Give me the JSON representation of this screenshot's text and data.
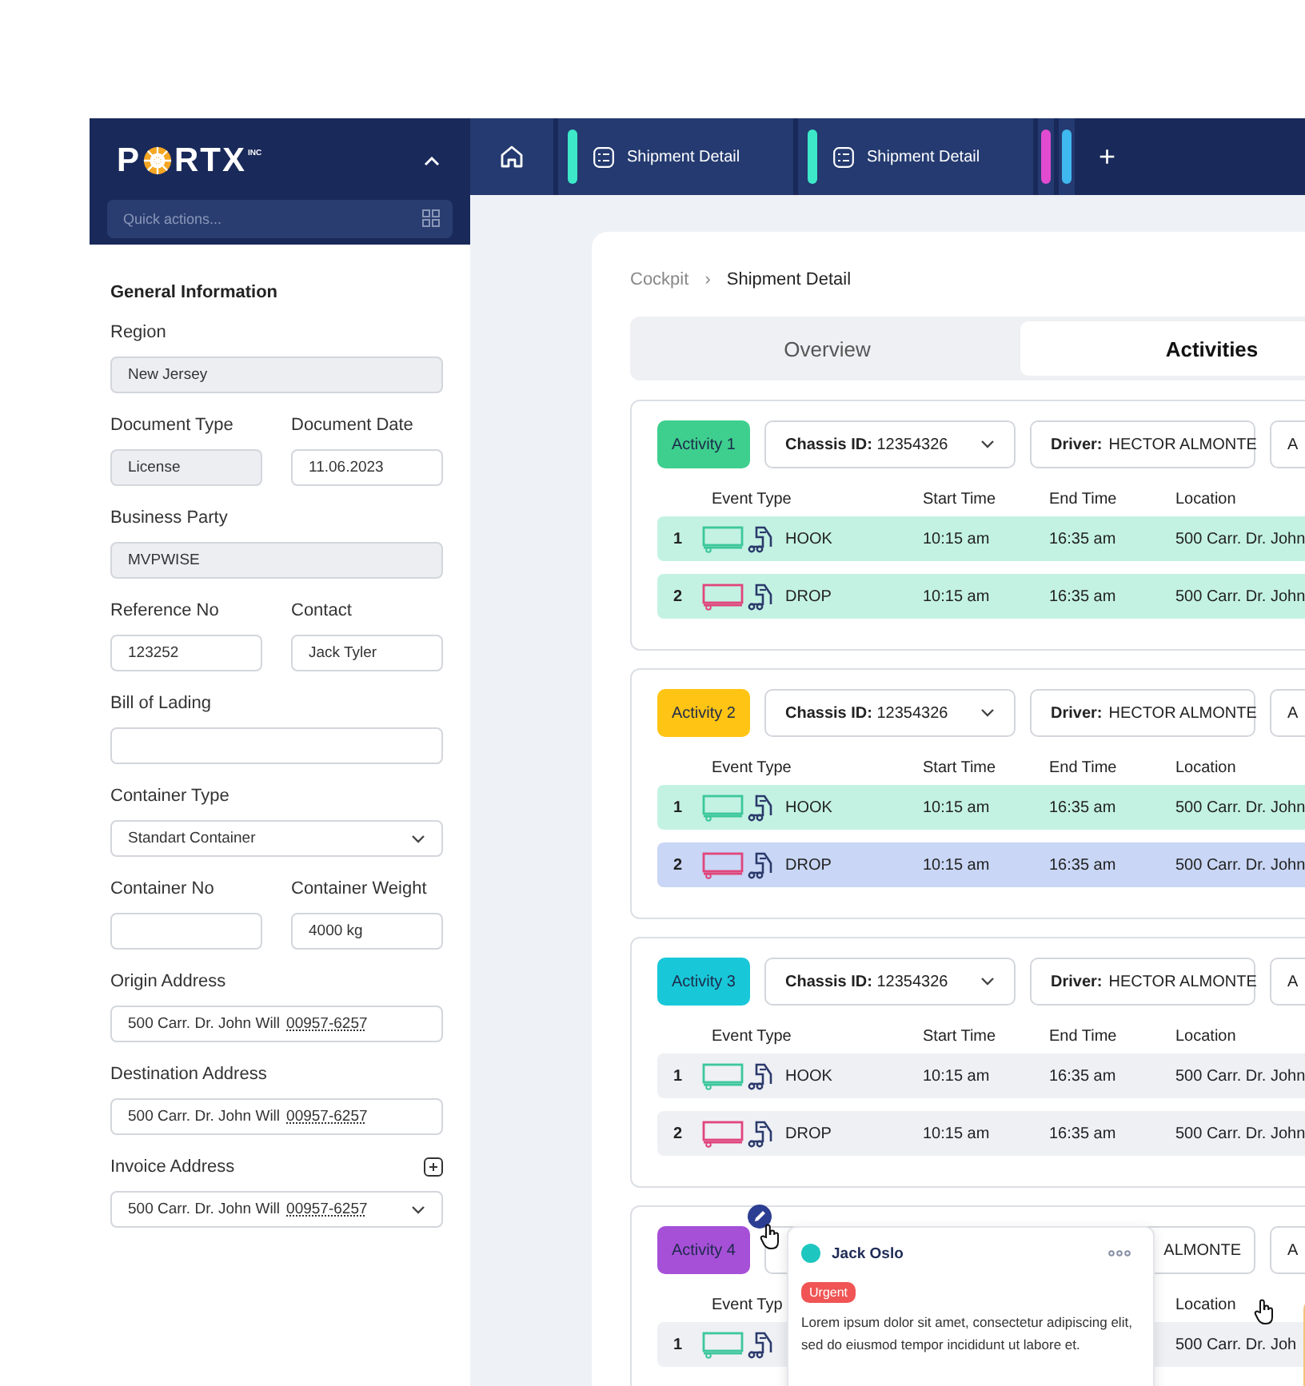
{
  "sidebar": {
    "logo": {
      "before": "P",
      "after": "RTX",
      "suffix": "INC"
    },
    "quick_actions": {
      "placeholder": "Quick actions..."
    },
    "section_title": "General Information",
    "rows": [
      [
        {
          "label": "Region",
          "value": "New Jersey",
          "kind": "readonly"
        }
      ],
      [
        {
          "label": "Document Type",
          "value": "License",
          "kind": "readonly"
        },
        {
          "label": "Document Date",
          "value": "11.06.2023",
          "kind": "input"
        }
      ],
      [
        {
          "label": "Business Party",
          "value": "MVPWISE",
          "kind": "readonly"
        }
      ],
      [
        {
          "label": "Reference No",
          "value": "123252",
          "kind": "input"
        },
        {
          "label": "Contact",
          "value": "Jack Tyler",
          "kind": "input"
        }
      ],
      [
        {
          "label": "Bill of Lading",
          "kind": "input"
        }
      ],
      [
        {
          "label": "Container Type",
          "value": "Standart Container",
          "kind": "select"
        }
      ],
      [
        {
          "label": "Container No",
          "kind": "input"
        },
        {
          "label": "Container Weight",
          "value": "4000 kg",
          "kind": "input"
        }
      ],
      [
        {
          "label": "Origin Address",
          "value": "500 Carr. Dr. John Will",
          "code": "00957-6257",
          "kind": "input"
        }
      ],
      [
        {
          "label": "Destination Address",
          "value": "500 Carr. Dr. John Will",
          "code": "00957-6257",
          "kind": "input"
        }
      ],
      [
        {
          "label": "Invoice Address",
          "value": "500 Carr. Dr. John Will",
          "code": "00957-6257",
          "kind": "select",
          "add_button": true
        }
      ]
    ]
  },
  "top_tabs": [
    {
      "kind": "home"
    },
    {
      "kind": "page",
      "label": "Shipment Detail",
      "color": "#3de8c8"
    },
    {
      "kind": "page",
      "label": "Shipment Detail",
      "color": "#3de8c8"
    },
    {
      "kind": "stub",
      "color": "#e04bd0"
    },
    {
      "kind": "stub",
      "color": "#3fb8ef"
    },
    {
      "kind": "add",
      "label": "+"
    }
  ],
  "breadcrumb": {
    "items": [
      "Cockpit",
      "Shipment Detail"
    ],
    "separator": "›"
  },
  "view_tabs": [
    {
      "label": "Overview",
      "selected": false
    },
    {
      "label": "Activities",
      "selected": true
    }
  ],
  "activities": [
    {
      "label": "Activity 1",
      "color": "#3ecf8e",
      "chassis": {
        "label": "Chassis ID:",
        "value": "12354326"
      },
      "driver": {
        "label": "Driver:",
        "value": "HECTOR ALMONTE"
      },
      "field_3": "A",
      "header": {
        "event_type": "Event Type",
        "start_time": "Start Time",
        "end_time": "End Time",
        "location": "Location"
      },
      "rows": [
        {
          "num": "1",
          "kind": "hook",
          "event": "HOOK",
          "start": "10:15 am",
          "end": "16:35 am",
          "location": "500 Carr. Dr. John",
          "color": "#c3f2e3"
        },
        {
          "num": "2",
          "kind": "drop",
          "event": "DROP",
          "start": "10:15 am",
          "end": "16:35 am",
          "location": "500 Carr. Dr. John",
          "color": "#c3f2e3"
        }
      ]
    },
    {
      "label": "Activity 2",
      "color": "#ffc414",
      "chassis": {
        "label": "Chassis ID:",
        "value": "12354326"
      },
      "driver": {
        "label": "Driver:",
        "value": "HECTOR ALMONTE"
      },
      "field_3": "A",
      "header": {
        "event_type": "Event Type",
        "start_time": "Start Time",
        "end_time": "End Time",
        "location": "Location"
      },
      "rows": [
        {
          "num": "1",
          "kind": "hook",
          "event": "HOOK",
          "start": "10:15 am",
          "end": "16:35 am",
          "location": "500 Carr. Dr. John",
          "color": "#c3f2e3"
        },
        {
          "num": "2",
          "kind": "drop",
          "event": "DROP",
          "start": "10:15 am",
          "end": "16:35 am",
          "location": "500 Carr. Dr. John",
          "color": "#c9d6f5"
        }
      ]
    },
    {
      "label": "Activity 3",
      "color": "#18c8d8",
      "chassis": {
        "label": "Chassis ID:",
        "value": "12354326"
      },
      "driver": {
        "label": "Driver:",
        "value": "HECTOR ALMONTE"
      },
      "field_3": "A",
      "header": {
        "event_type": "Event Type",
        "start_time": "Start Time",
        "end_time": "End Time",
        "location": "Location"
      },
      "rows": [
        {
          "num": "1",
          "kind": "hook",
          "event": "HOOK",
          "start": "10:15 am",
          "end": "16:35 am",
          "location": "500 Carr. Dr. John",
          "color": "#eef0f4"
        },
        {
          "num": "2",
          "kind": "drop",
          "event": "DROP",
          "start": "10:15 am",
          "end": "16:35 am",
          "location": "500 Carr. Dr. John",
          "color": "#eef0f4"
        }
      ]
    },
    {
      "label": "Activity 4",
      "color": "#a650d8",
      "driver": {
        "value": "ALMONTE"
      },
      "field_3": "A",
      "header": {
        "event_type": "Event Typ",
        "location": "Location"
      },
      "rows": [
        {
          "num": "1",
          "kind": "hook",
          "location": "500 Carr. Dr. Joh",
          "color": "#eef0f4"
        }
      ],
      "comment": {
        "author": "Jack Oslo",
        "tag": "Urgent",
        "text": "Lorem ipsum dolor sit amet, consectetur adipiscing elit, sed do eiusmod tempor incididunt ut labore et."
      }
    }
  ]
}
